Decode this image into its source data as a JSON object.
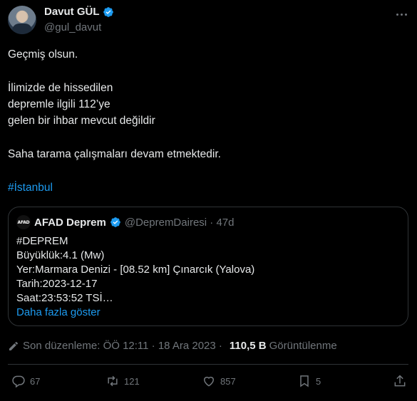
{
  "author": {
    "name": "Davut GÜL",
    "handle": "@gul_davut"
  },
  "tweet": {
    "line1": "Geçmiş olsun.",
    "line2": "İlimizde de hissedilen",
    "line3": "depremle ilgili 112’ye",
    "line4": "gelen bir ihbar mevcut değildir",
    "line5": "Saha tarama çalışmaları devam etmektedir.",
    "hashtag": "#İstanbul"
  },
  "quote": {
    "avatar_text": "AFAD",
    "name": "AFAD Deprem",
    "handle_time": "@DepremDairesi · 47d",
    "lines": [
      "#DEPREM",
      "Büyüklük:4.1 (Mw)",
      "Yer:Marmara Denizi - [08.52 km] Çınarcık (Yalova)",
      "Tarih:2023-12-17",
      "Saat:23:53:52 TSİ…"
    ],
    "show_more": "Daha fazla göster"
  },
  "meta": {
    "edited": "Son düzenleme: ÖÖ 12:11 · 18 Ara 2023 ·",
    "views_count": "110,5 B",
    "views_label": "Görüntülenme"
  },
  "actions": {
    "replies": "67",
    "reposts": "121",
    "likes": "857",
    "bookmarks": "5"
  },
  "icons": [
    "verified-badge-icon",
    "more-icon",
    "pencil-icon",
    "reply-icon",
    "repost-icon",
    "like-icon",
    "bookmark-icon",
    "share-icon"
  ],
  "colors": {
    "background": "#000000",
    "text": "#e7e9ea",
    "muted": "#71767b",
    "link": "#1d9bf0",
    "border": "#2f3336"
  }
}
